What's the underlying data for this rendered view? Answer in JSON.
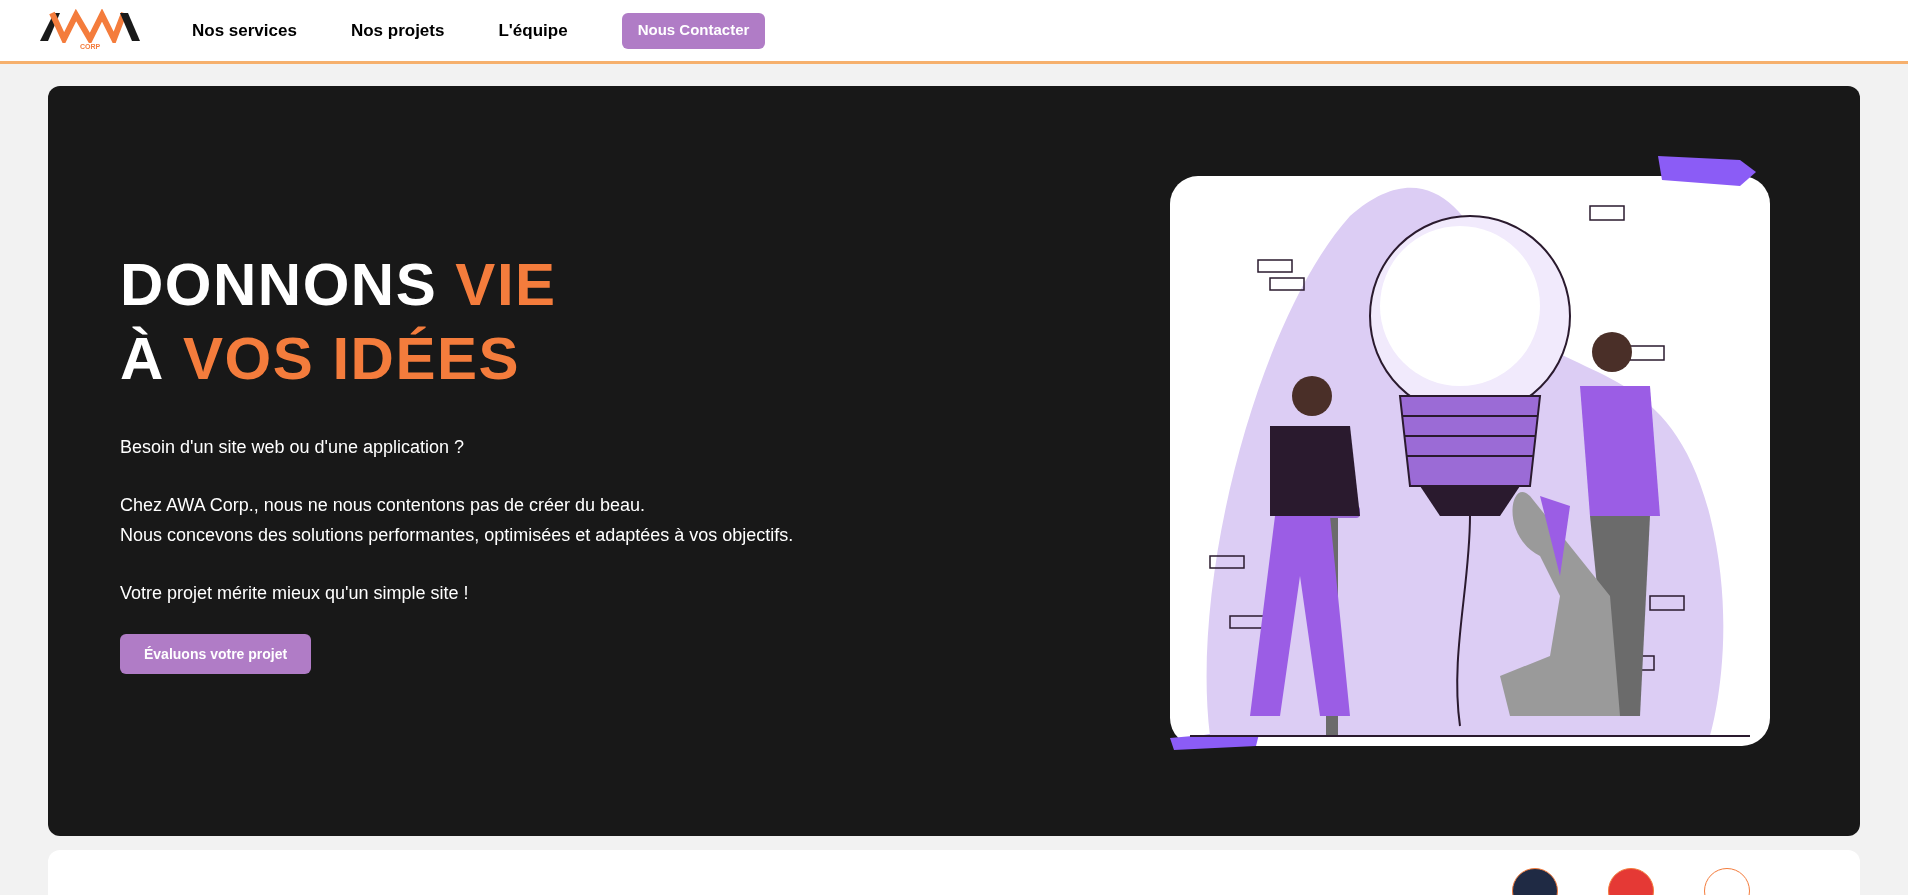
{
  "header": {
    "logo": {
      "text": "CORP"
    },
    "nav": [
      {
        "label": "Nos services",
        "kind": "link"
      },
      {
        "label": "Nos projets",
        "kind": "link"
      },
      {
        "label": "L'équipe",
        "kind": "link"
      },
      {
        "label": "Nous Contacter",
        "kind": "button"
      }
    ]
  },
  "hero": {
    "headline": [
      [
        {
          "text": "DONNONS ",
          "accent": false
        },
        {
          "text": "VIE",
          "accent": true
        }
      ],
      [
        {
          "text": "À ",
          "accent": false
        },
        {
          "text": "VOS IDÉES",
          "accent": true
        }
      ]
    ],
    "paragraphs": [
      [
        "Besoin d'un site web ou d'une application ?"
      ],
      [
        "Chez AWA Corp., nous ne nous contentons pas de créer du beau.",
        "Nous concevons des solutions performantes, optimisées et adaptées à vos objectifs."
      ],
      [
        "Votre projet mérite mieux qu'un simple site !"
      ]
    ],
    "cta": "Évaluons votre projet"
  },
  "clients": {
    "logos": [
      {
        "color": "#1f2a44"
      },
      {
        "color": "#e53935"
      },
      {
        "color": "#ffffff"
      }
    ]
  }
}
